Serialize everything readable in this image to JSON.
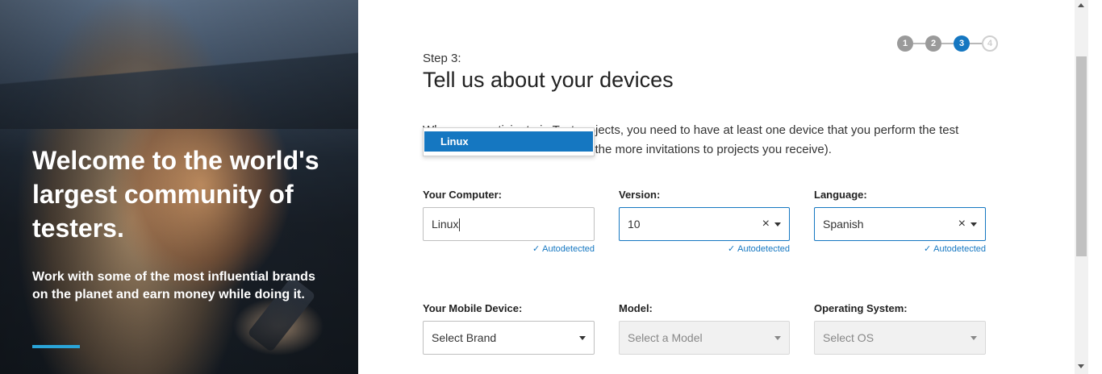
{
  "hero": {
    "headline": "Welcome to the world's largest community of testers.",
    "subtext": "Work with some of the most influential brands on the planet and earn money while doing it."
  },
  "stepper": {
    "steps": [
      "1",
      "2",
      "3",
      "4"
    ],
    "current": 3
  },
  "main": {
    "step_label": "Step 3:",
    "title": "Tell us about your devices",
    "intro_line1": "When you participate in Test projects, you need to have at least one device that you perform the test",
    "intro_line2": "on (the more devices you have, the more invitations to projects you receive)."
  },
  "computer_dropdown": {
    "options": [
      "Linux"
    ],
    "highlighted": "Linux"
  },
  "computer": {
    "label": "Your Computer:",
    "value": "Linux",
    "autodetected": "Autodetected"
  },
  "version": {
    "label": "Version:",
    "value": "10",
    "autodetected": "Autodetected"
  },
  "language": {
    "label": "Language:",
    "value": "Spanish",
    "autodetected": "Autodetected"
  },
  "mobile": {
    "label": "Your Mobile Device:",
    "value": "Select Brand"
  },
  "model": {
    "label": "Model:",
    "placeholder": "Select a Model"
  },
  "os": {
    "label": "Operating System:",
    "placeholder": "Select OS"
  },
  "icons": {
    "clear": "×",
    "check": "✓"
  },
  "colors": {
    "accent": "#1577c1",
    "hero_accent": "#2aa4d8"
  }
}
